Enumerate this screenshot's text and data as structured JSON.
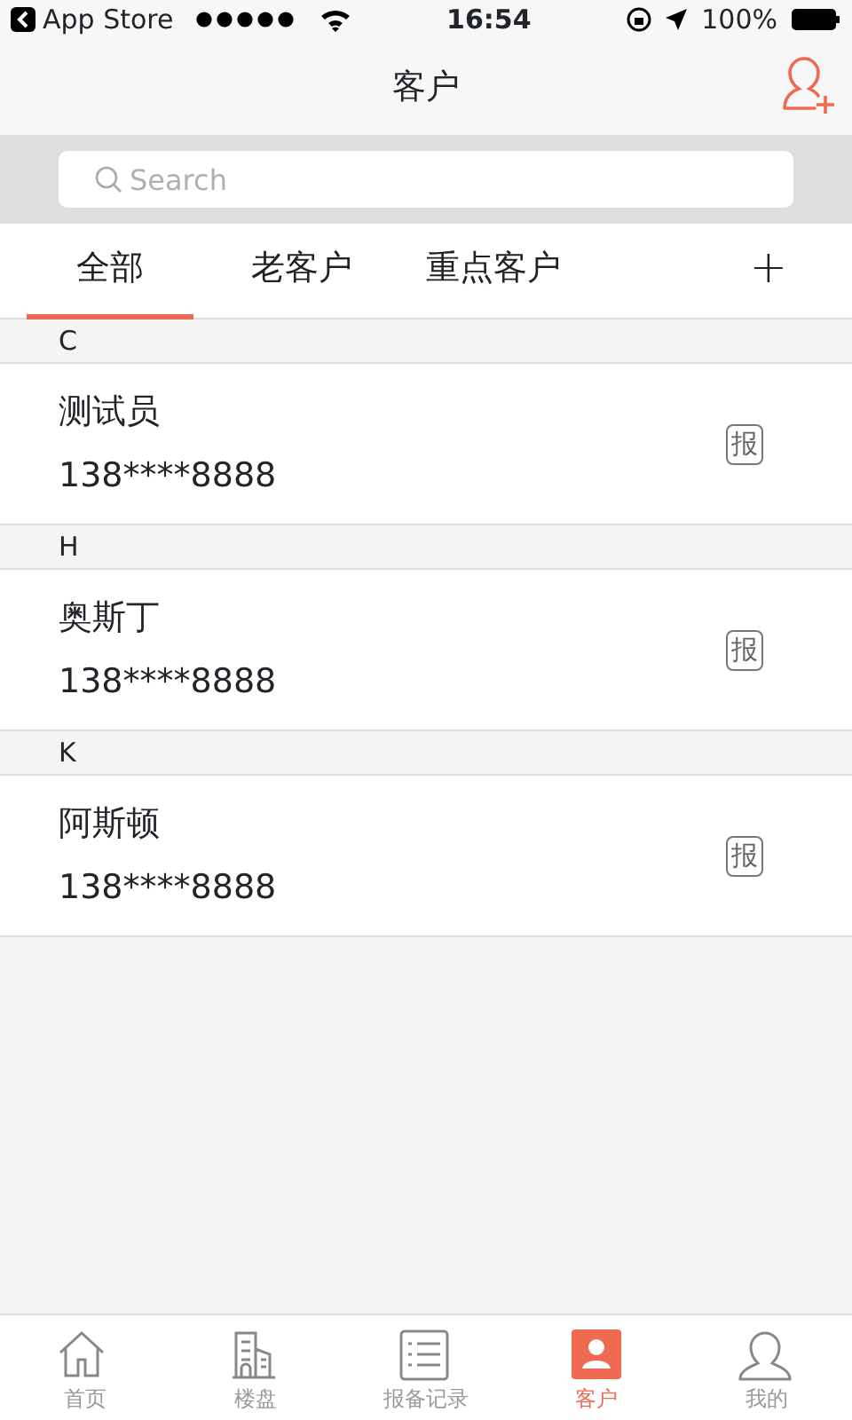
{
  "status_bar": {
    "back_label": "App Store",
    "time": "16:54",
    "battery": "100%"
  },
  "nav": {
    "title": "客户"
  },
  "search": {
    "placeholder": "Search"
  },
  "tabs": [
    {
      "label": "全部",
      "selected": true
    },
    {
      "label": "老客户",
      "selected": false
    },
    {
      "label": "重点客户",
      "selected": false
    }
  ],
  "add_tab": "+",
  "sections": [
    {
      "letter": "C",
      "customers": [
        {
          "name": "测试员",
          "phone": "138****8888",
          "action": "报"
        }
      ]
    },
    {
      "letter": "H",
      "customers": [
        {
          "name": "奥斯丁",
          "phone": "138****8888",
          "action": "报"
        }
      ]
    },
    {
      "letter": "K",
      "customers": [
        {
          "name": "阿斯顿",
          "phone": "138****8888",
          "action": "报"
        }
      ]
    }
  ],
  "bottom_tabs": [
    {
      "kind": "home",
      "label": "首页",
      "selected": false
    },
    {
      "kind": "building",
      "label": "楼盘",
      "selected": false
    },
    {
      "kind": "list",
      "label": "报备记录",
      "selected": false
    },
    {
      "kind": "contact",
      "label": "客户",
      "selected": true
    },
    {
      "kind": "person",
      "label": "我的",
      "selected": false
    }
  ]
}
